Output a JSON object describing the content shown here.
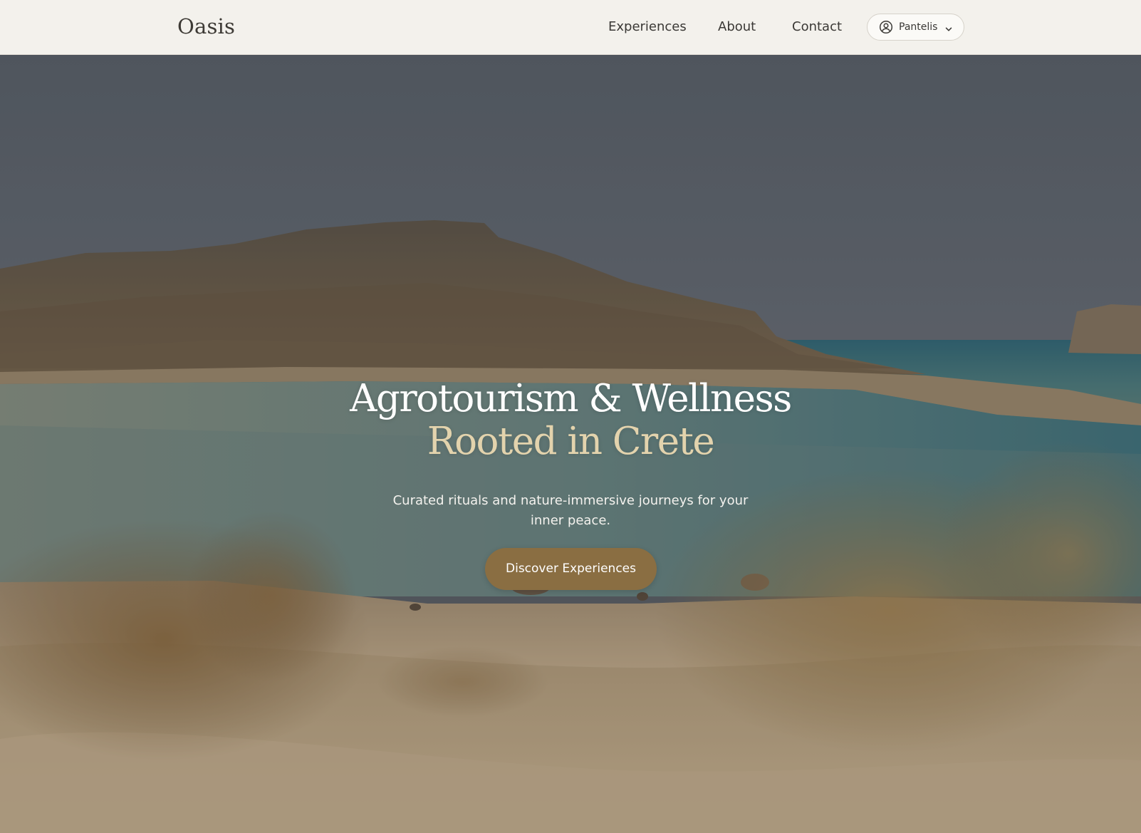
{
  "header": {
    "logo": "Oasis",
    "nav": [
      {
        "label": "Experiences"
      },
      {
        "label": "About"
      },
      {
        "label": "Contact"
      }
    ],
    "user": {
      "name": "Pantelis",
      "icon": "user-circle-icon",
      "dropdown_icon": "chevron-down-icon"
    }
  },
  "hero": {
    "title_line_1": "Agrotourism & Wellness",
    "title_line_2": "Rooted in Crete",
    "subtitle": "Curated rituals and nature-immersive journeys for your inner peace.",
    "cta_label": "Discover Experiences"
  },
  "colors": {
    "header_bg": "#f3f1ec",
    "accent_text": "#e3d3ad",
    "cta_bg": "#8a6e42",
    "logo_text": "#3d3a35"
  }
}
